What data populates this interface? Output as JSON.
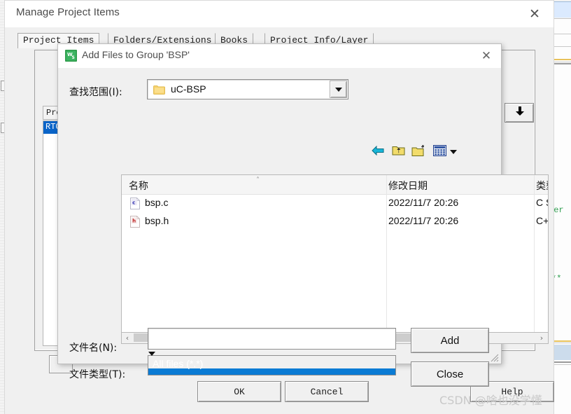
{
  "background": {
    "window_title": "Manage Project Items",
    "close_label": "✕",
    "tabs": [
      {
        "label": "Project Items",
        "active": true
      },
      {
        "label": "Folders/Extensions",
        "active": false
      },
      {
        "label": "Books",
        "active": false
      },
      {
        "label": "Project Info/Layer",
        "active": false
      }
    ],
    "project_header": "Proje",
    "project_selected_item": "RTOS",
    "move_down_icon": "down-arrow-icon",
    "buttons": [
      {
        "label": "OK",
        "name": "ok-button"
      },
      {
        "label": "Cancel",
        "name": "cancel-button"
      },
      {
        "label": "Help",
        "name": "help-button"
      }
    ],
    "code_fragments": [
      "ber",
      ")",
      "**"
    ]
  },
  "dialog": {
    "title": "Add Files to Group 'BSP'",
    "app_icon": "uvision-icon",
    "close_label": "✕",
    "lookin": {
      "label": "查找范围(I):",
      "value": "uC-BSP",
      "folder_icon": "folder-icon",
      "dropdown_icon": "chevron-down-icon"
    },
    "toolbar": [
      {
        "name": "back-icon",
        "title": "back"
      },
      {
        "name": "up-folder-icon",
        "title": "up one level"
      },
      {
        "name": "new-folder-icon",
        "title": "new folder"
      },
      {
        "name": "views-icon",
        "title": "views"
      },
      {
        "name": "views-chevron-icon",
        "title": "views menu"
      }
    ],
    "list": {
      "columns": [
        "名称",
        "修改日期",
        "类型"
      ],
      "sort_caret": "˄",
      "rows": [
        {
          "name": "bsp.c",
          "icon": "c-file-icon",
          "modified": "2022/11/7 20:26",
          "type": "C S"
        },
        {
          "name": "bsp.h",
          "icon": "h-file-icon",
          "modified": "2022/11/7 20:26",
          "type": "C+"
        }
      ]
    },
    "hscroll": {
      "left_arrow": "‹",
      "right_arrow": "›"
    },
    "filename": {
      "label": "文件名(N):",
      "value": "",
      "placeholder": ""
    },
    "filetype": {
      "label": "文件类型(T):",
      "value": "All files (*.*)",
      "dropdown_icon": "chevron-down-icon"
    },
    "buttons": [
      {
        "label": "Add",
        "name": "add-button"
      },
      {
        "label": "Close",
        "name": "close-button"
      }
    ]
  },
  "watermark": {
    "text": "CSDN @啥也没学懂"
  },
  "colors": {
    "selection_blue": "#0a7bd4",
    "list_selection": "#0a64c8",
    "dialog_bg": "#f0f0f0",
    "title_bg": "#ffffff",
    "comment_green": "#2f9e4f"
  }
}
